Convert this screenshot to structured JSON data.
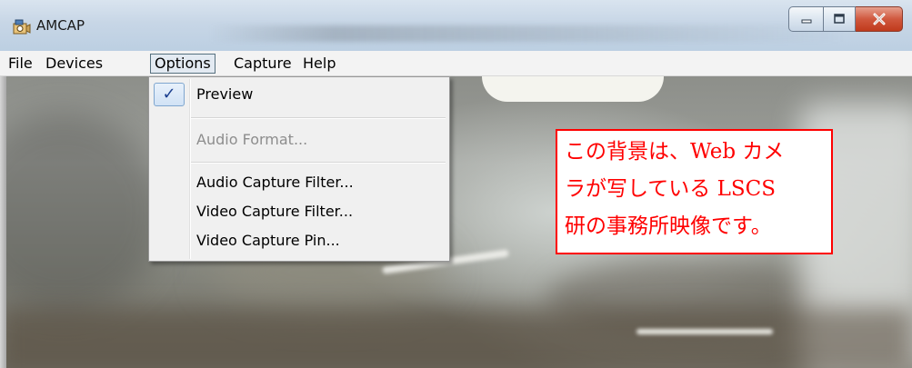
{
  "window": {
    "title": "AMCAP",
    "icon": "amcap-camera-icon",
    "controls": [
      "minimize-icon",
      "maximize-icon",
      "close-icon"
    ]
  },
  "menubar": {
    "items": [
      {
        "label": "File"
      },
      {
        "label": "Devices"
      },
      {
        "label": "Options"
      },
      {
        "label": "Capture"
      },
      {
        "label": "Help"
      }
    ],
    "open": "Options"
  },
  "options_menu": {
    "items": [
      {
        "label": "Preview",
        "checked": true,
        "enabled": true
      },
      {
        "label": "Audio Format...",
        "checked": false,
        "enabled": false
      },
      {
        "label": "Audio Capture Filter...",
        "checked": false,
        "enabled": true
      },
      {
        "label": "Video Capture Filter...",
        "checked": false,
        "enabled": true
      },
      {
        "label": "Video Capture Pin...",
        "checked": false,
        "enabled": true
      }
    ],
    "check_glyph": "✓"
  },
  "annotation": {
    "lines": [
      "この背景は、Web カメ",
      "ラが写している LSCS",
      "研の事務所映像です。"
    ],
    "color": "#ff0000"
  }
}
